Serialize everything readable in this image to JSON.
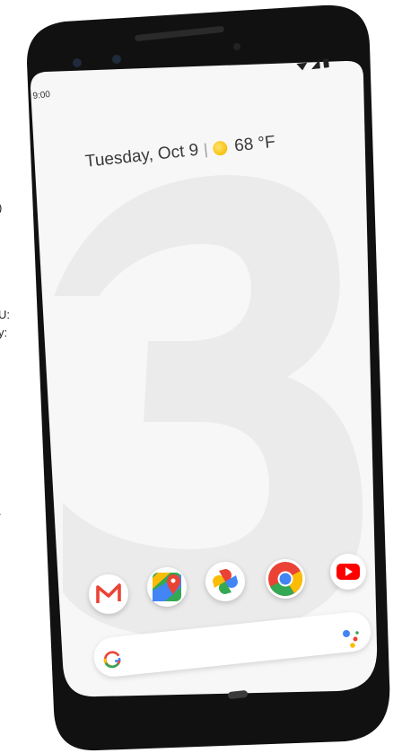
{
  "edge_text": [
    ")",
    "U:",
    "y:",
    "."
  ],
  "status_bar": {
    "time": "9:00",
    "icons": [
      "wifi-icon",
      "signal-icon",
      "battery-icon"
    ]
  },
  "lock_widget": {
    "date": "Tuesday, Oct 9",
    "separator": "|",
    "weather_icon": "sun-icon",
    "temperature": "68 °F"
  },
  "home_wallpaper": {
    "big_numeral": "3",
    "color": "#eeeeee"
  },
  "dock_apps": [
    {
      "name": "Gmail",
      "icon": "gmail-icon"
    },
    {
      "name": "Maps",
      "icon": "maps-icon"
    },
    {
      "name": "Photos",
      "icon": "photos-icon"
    },
    {
      "name": "Chrome",
      "icon": "chrome-icon"
    },
    {
      "name": "YouTube",
      "icon": "youtube-icon"
    }
  ],
  "search_bar": {
    "logo": "G",
    "assistant_icon": "assistant-icon"
  },
  "nav_bar": {
    "home_pill": "home-pill"
  },
  "colors": {
    "phone_frame": "#111111",
    "screen_bg": "#f7f7f7",
    "accent_green": "#7ee3b8"
  }
}
